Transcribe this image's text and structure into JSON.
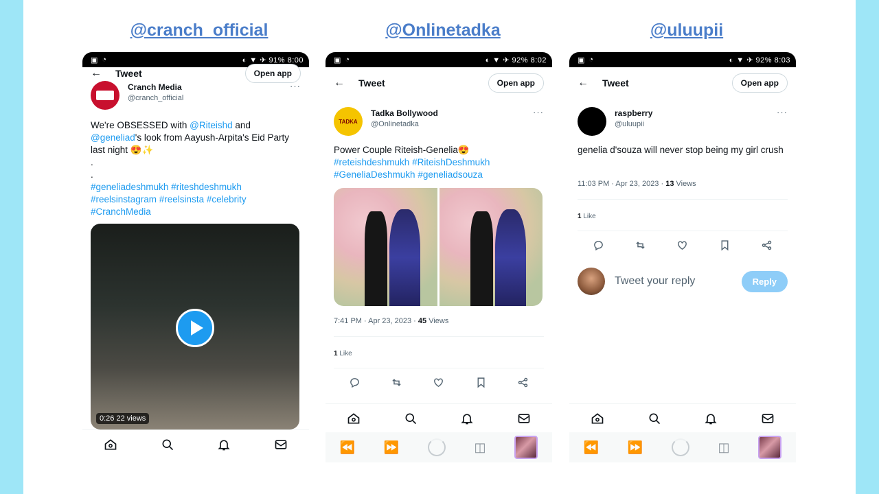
{
  "colors": {
    "side_bar": "#9ee6f7",
    "handle": "#4a7dc9",
    "link": "#1d9bf0",
    "reply_button": "#8ecdf8"
  },
  "icons": {
    "back": "arrow-left-icon",
    "more": "ellipsis-icon",
    "actions": [
      "reply-icon",
      "retweet-icon",
      "like-icon",
      "bookmark-icon",
      "share-icon"
    ],
    "nav": [
      "home-icon",
      "search-icon",
      "notifications-icon",
      "messages-icon"
    ],
    "browser": [
      "rewind-icon",
      "forward-icon",
      "loading-icon",
      "tabs-icon"
    ]
  },
  "panels": [
    {
      "handle": "@cranch_official",
      "status": {
        "time": "8:00",
        "battery": "91%"
      },
      "header": {
        "title": "Tweet",
        "open_app": "Open app"
      },
      "tweet": {
        "display_name": "Cranch Media",
        "username": "@cranch_official",
        "text_plain_1": "We're OBSESSED with ",
        "link_1": "@Riteishd",
        "text_plain_2": " and ",
        "link_2": "@geneliad",
        "text_plain_3": "'s look from Aayush-Arpita's Eid Party last night 😍✨",
        "dots": ".",
        "hashtags": "#geneliadeshmukh #riteshdeshmukh #reelsinstagram #reelsinsta #celebrity #CranchMedia"
      },
      "video": {
        "duration": "0:26",
        "views": "22 views"
      }
    },
    {
      "handle": "@Onlinetadka",
      "status": {
        "time": "8:02",
        "battery": "92%"
      },
      "header": {
        "title": "Tweet",
        "open_app": "Open app"
      },
      "tweet": {
        "display_name": "Tadka Bollywood",
        "username": "@Onlinetadka",
        "avatar_text": "TADKA",
        "text": "Power Couple Riteish-Genelia😍",
        "hashtags": "#reteishdeshmukh #RiteishDeshmukh #GeneliaDeshmukh #geneliadsouza",
        "timestamp": "7:41 PM · Apr 23, 2023 · ",
        "views_count": "45",
        "views_label": " Views",
        "likes_count": "1",
        "likes_label": " Like"
      }
    },
    {
      "handle": "@uluupii",
      "status": {
        "time": "8:03",
        "battery": "92%"
      },
      "header": {
        "title": "Tweet",
        "open_app": "Open app"
      },
      "tweet": {
        "display_name": "raspberry",
        "username": "@uluupii",
        "text": "genelia d'souza will never stop being my girl crush",
        "timestamp": "11:03 PM · Apr 23, 2023 · ",
        "views_count": "13",
        "views_label": " Views",
        "likes_count": "1",
        "likes_label": " Like"
      },
      "reply": {
        "placeholder": "Tweet your reply",
        "button": "Reply"
      }
    }
  ]
}
